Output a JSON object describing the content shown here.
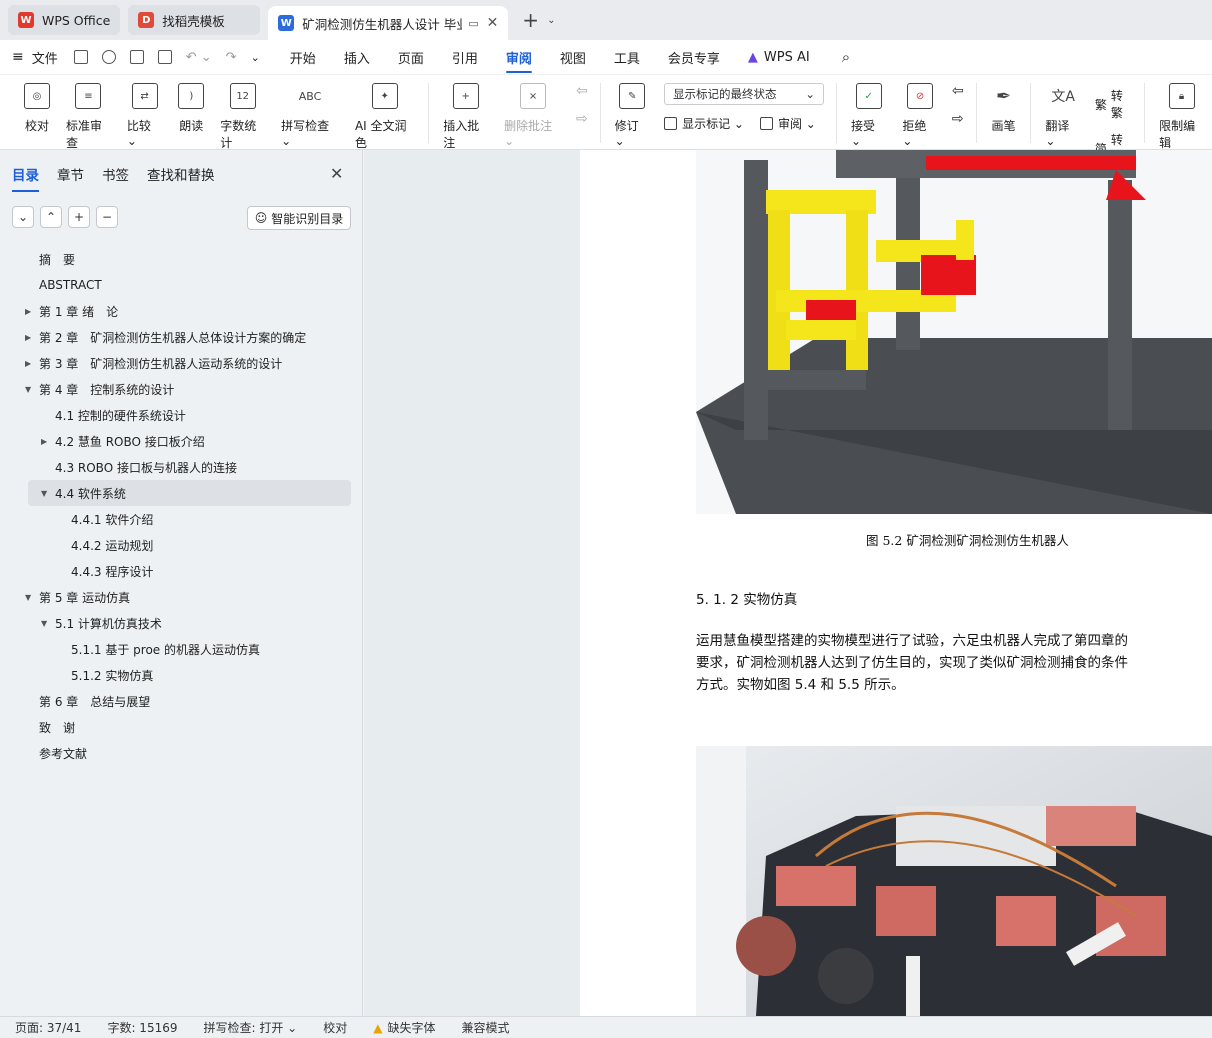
{
  "tabs": [
    {
      "label": "WPS Office",
      "icon": "wps-logo-icon",
      "color": "#e03a2f"
    },
    {
      "label": "找稻壳模板",
      "icon": "docer-logo-icon",
      "color": "#e04a3a"
    },
    {
      "label": "矿洞检测仿生机器人设计 毕业",
      "icon": "word-doc-icon",
      "color": "#2b6bdc"
    }
  ],
  "menu": {
    "file": "文件",
    "items": [
      "开始",
      "插入",
      "页面",
      "引用",
      "审阅",
      "视图",
      "工具",
      "会员专享"
    ],
    "active": "审阅",
    "wps_ai": "WPS AI"
  },
  "toolbar": {
    "proofread": "校对",
    "standard_review": "标准审查",
    "compare": "比较",
    "read_aloud": "朗读",
    "word_count": "字数统计",
    "spell_check": "拼写检查",
    "ai_polish": "AI 全文润色",
    "insert_comment": "插入批注",
    "delete_comment": "删除批注",
    "revise": "修订",
    "markup_dropdown": "显示标记的最终状态",
    "show_markup": "显示标记",
    "review": "审阅",
    "accept": "接受",
    "reject": "拒绝",
    "pen": "画笔",
    "translate": "翻译",
    "to_traditional": "转繁",
    "to_simplified": "转简",
    "restrict_edit": "限制编辑"
  },
  "panel": {
    "tabs": [
      "目录",
      "章节",
      "书签",
      "查找和替换"
    ],
    "smart_toc": "智能识别目录"
  },
  "toc": [
    {
      "text": "摘　要",
      "level": 0,
      "arrow": ""
    },
    {
      "text": "ABSTRACT",
      "level": 0,
      "arrow": ""
    },
    {
      "text": "第 1 章  绪　论",
      "level": 0,
      "arrow": "right"
    },
    {
      "text": "第 2 章　矿洞检测仿生机器人总体设计方案的确定",
      "level": 0,
      "arrow": "right"
    },
    {
      "text": "第 3 章　矿洞检测仿生机器人运动系统的设计",
      "level": 0,
      "arrow": "right"
    },
    {
      "text": "第 4 章　控制系统的设计",
      "level": 0,
      "arrow": "down"
    },
    {
      "text": "4.1 控制的硬件系统设计",
      "level": 1,
      "arrow": ""
    },
    {
      "text": "4.2 慧鱼  ROBO 接口板介绍",
      "level": 1,
      "arrow": "right"
    },
    {
      "text": "4.3 ROBO 接口板与机器人的连接",
      "level": 1,
      "arrow": ""
    },
    {
      "text": "4.4 软件系统",
      "level": 1,
      "arrow": "down",
      "selected": true
    },
    {
      "text": "4.4.1 软件介绍",
      "level": 2,
      "arrow": ""
    },
    {
      "text": "4.4.2 运动规划",
      "level": 2,
      "arrow": ""
    },
    {
      "text": "4.4.3 程序设计",
      "level": 2,
      "arrow": ""
    },
    {
      "text": "第 5 章  运动仿真",
      "level": 0,
      "arrow": "down"
    },
    {
      "text": "5.1 计算机仿真技术",
      "level": 1,
      "arrow": "down"
    },
    {
      "text": "5.1.1 基于 proe 的机器人运动仿真",
      "level": 2,
      "arrow": ""
    },
    {
      "text": "5.1.2 实物仿真",
      "level": 2,
      "arrow": ""
    },
    {
      "text": "第 6 章　总结与展望",
      "level": 0,
      "arrow": ""
    },
    {
      "text": "致　谢",
      "level": 0,
      "arrow": ""
    },
    {
      "text": "参考文献",
      "level": 0,
      "arrow": ""
    }
  ],
  "document": {
    "caption": "图 5.2  矿洞检测矿洞检测仿生机器人",
    "heading": "5. 1. 2 实物仿真",
    "paragraph": "运用慧鱼模型搭建的实物模型进行了试验，六足虫机器人完成了第四章的\n要求，矿洞检测机器人达到了仿生目的，实现了类似矿洞检测捕食的条件\n方式。实物如图 5.4 和 5.5 所示。"
  },
  "status": {
    "page": "页面: 37/41",
    "words": "字数: 15169",
    "spell": "拼写检查: 打开",
    "proof": "校对",
    "missing_font": "缺失字体",
    "compat": "兼容模式"
  }
}
